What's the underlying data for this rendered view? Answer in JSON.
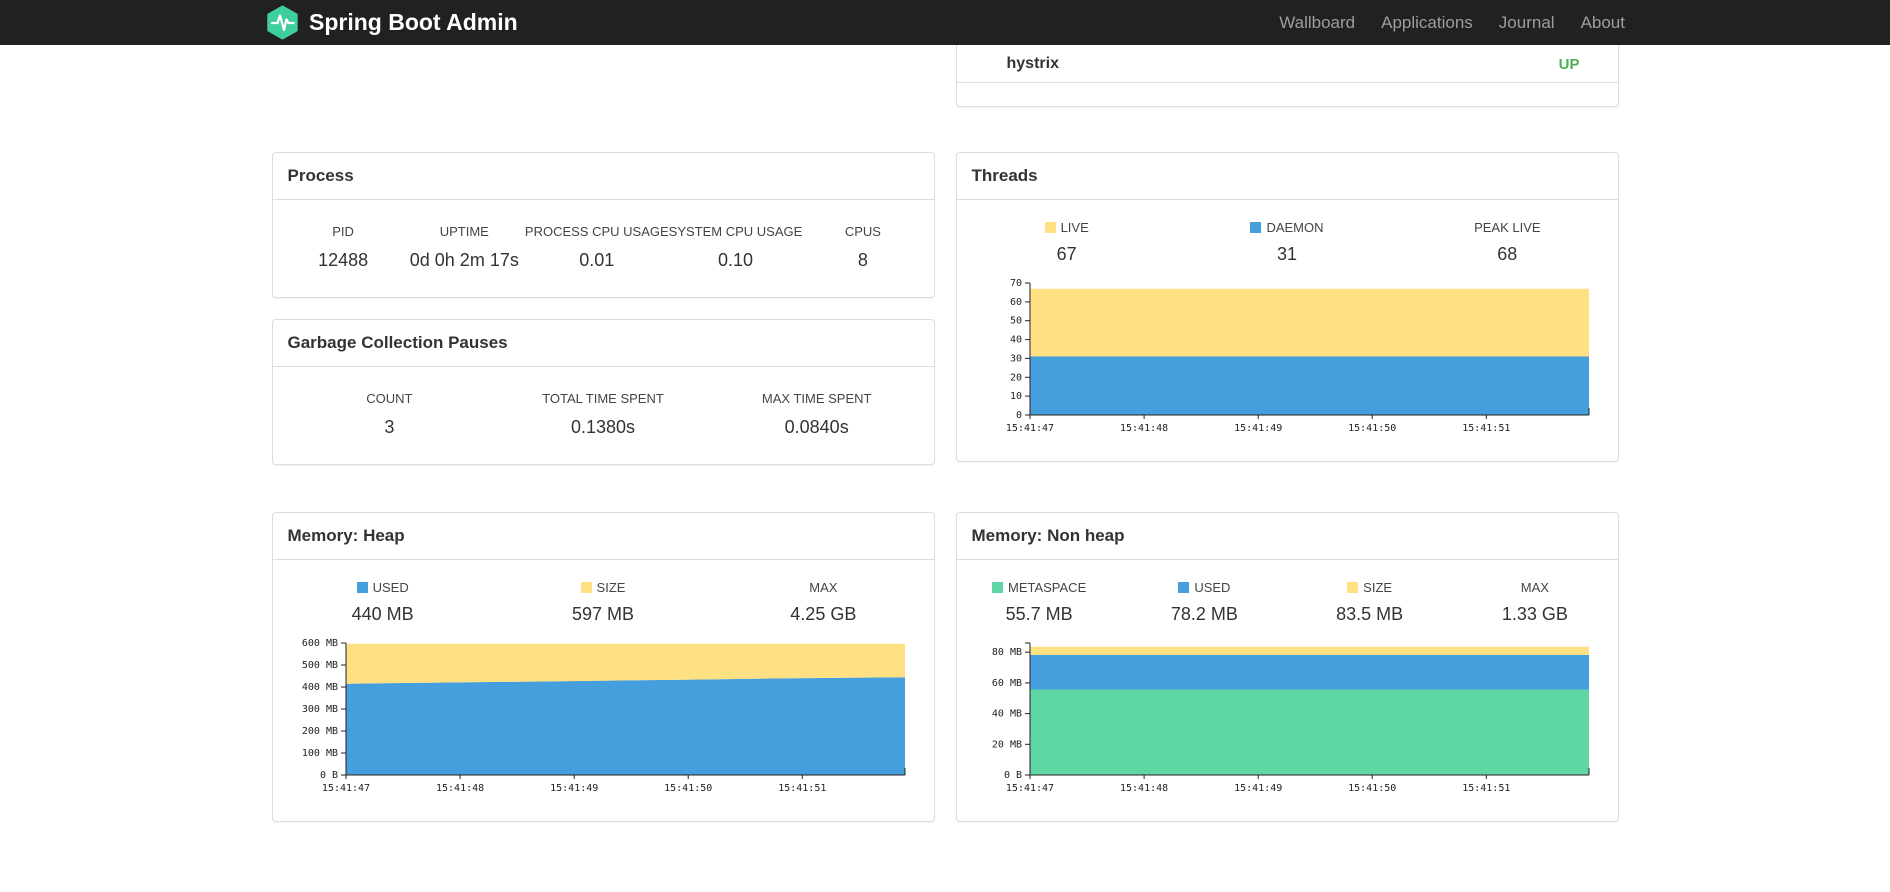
{
  "navbar": {
    "brand": "Spring Boot Admin",
    "links": [
      {
        "label": "Wallboard"
      },
      {
        "label": "Applications"
      },
      {
        "label": "Journal"
      },
      {
        "label": "About"
      }
    ]
  },
  "health_panel": {
    "service": "hystrix",
    "status": "UP",
    "status_color": "#4caf50"
  },
  "process_panel": {
    "title": "Process",
    "stats": [
      {
        "label": "PID",
        "value": "12488"
      },
      {
        "label": "UPTIME",
        "value": "0d 0h 2m 17s"
      },
      {
        "label": "PROCESS CPU USAGE",
        "value": "0.01"
      },
      {
        "label": "SYSTEM CPU USAGE",
        "value": "0.10"
      },
      {
        "label": "CPUS",
        "value": "8"
      }
    ]
  },
  "gc_panel": {
    "title": "Garbage Collection Pauses",
    "stats": [
      {
        "label": "COUNT",
        "value": "3"
      },
      {
        "label": "TOTAL TIME SPENT",
        "value": "0.1380s"
      },
      {
        "label": "MAX TIME SPENT",
        "value": "0.0840s"
      }
    ]
  },
  "threads_panel": {
    "title": "Threads",
    "legend": [
      {
        "label": "LIVE",
        "value": "67",
        "swatch": "#ffe082"
      },
      {
        "label": "DAEMON",
        "value": "31",
        "swatch": "#459fdc"
      },
      {
        "label": "PEAK LIVE",
        "value": "68",
        "swatch": null
      }
    ]
  },
  "heap_panel": {
    "title": "Memory: Heap",
    "legend": [
      {
        "label": "USED",
        "value": "440 MB",
        "swatch": "#459fdc"
      },
      {
        "label": "SIZE",
        "value": "597 MB",
        "swatch": "#ffe082"
      },
      {
        "label": "MAX",
        "value": "4.25 GB",
        "swatch": null
      }
    ]
  },
  "nonheap_panel": {
    "title": "Memory: Non heap",
    "legend": [
      {
        "label": "METASPACE",
        "value": "55.7 MB",
        "swatch": "#5fd7a4"
      },
      {
        "label": "USED",
        "value": "78.2 MB",
        "swatch": "#459fdc"
      },
      {
        "label": "SIZE",
        "value": "83.5 MB",
        "swatch": "#ffe082"
      },
      {
        "label": "MAX",
        "value": "1.33 GB",
        "swatch": null
      }
    ]
  },
  "chart_data": [
    {
      "name": "threads",
      "type": "area",
      "title": "Threads",
      "x_labels": [
        "15:41:47",
        "15:41:48",
        "15:41:49",
        "15:41:50",
        "15:41:51"
      ],
      "y_max": 70,
      "y_ticks": [
        {
          "label": "0",
          "value": 0
        },
        {
          "label": "10",
          "value": 10
        },
        {
          "label": "20",
          "value": 20
        },
        {
          "label": "30",
          "value": 30
        },
        {
          "label": "40",
          "value": 40
        },
        {
          "label": "50",
          "value": 50
        },
        {
          "label": "60",
          "value": 60
        },
        {
          "label": "70",
          "value": 70
        }
      ],
      "bands": [
        {
          "name": "daemon",
          "color": "#459fdc",
          "lower": [
            0
          ],
          "upper": [
            31
          ]
        },
        {
          "name": "live",
          "color": "#ffe082",
          "lower": [
            31
          ],
          "upper": [
            67
          ]
        }
      ],
      "legend_position": "top",
      "grid": false
    },
    {
      "name": "memory-heap",
      "type": "area",
      "title": "Memory: Heap",
      "x_labels": [
        "15:41:47",
        "15:41:48",
        "15:41:49",
        "15:41:50",
        "15:41:51"
      ],
      "y_max": 600,
      "y_ticks": [
        {
          "label": "0 B",
          "value": 0
        },
        {
          "label": "100 MB",
          "value": 100
        },
        {
          "label": "200 MB",
          "value": 200
        },
        {
          "label": "300 MB",
          "value": 300
        },
        {
          "label": "400 MB",
          "value": 400
        },
        {
          "label": "500 MB",
          "value": 500
        },
        {
          "label": "600 MB",
          "value": 600
        }
      ],
      "bands": [
        {
          "name": "used",
          "color": "#459fdc",
          "lower": [
            0
          ],
          "upper": [
            415,
            421,
            427,
            433,
            440,
            444
          ]
        },
        {
          "name": "size",
          "color": "#ffe082",
          "lower": [
            415,
            421,
            427,
            433,
            440,
            444
          ],
          "upper": [
            597
          ]
        }
      ],
      "legend_position": "top",
      "grid": false
    },
    {
      "name": "memory-nonheap",
      "type": "area",
      "title": "Memory: Non heap",
      "x_labels": [
        "15:41:47",
        "15:41:48",
        "15:41:49",
        "15:41:50",
        "15:41:51"
      ],
      "y_max": 86,
      "y_ticks": [
        {
          "label": "0 B",
          "value": 0
        },
        {
          "label": "20 MB",
          "value": 20
        },
        {
          "label": "40 MB",
          "value": 40
        },
        {
          "label": "60 MB",
          "value": 60
        },
        {
          "label": "80 MB",
          "value": 80
        }
      ],
      "bands": [
        {
          "name": "metaspace",
          "color": "#5fd7a4",
          "lower": [
            0
          ],
          "upper": [
            55.7
          ]
        },
        {
          "name": "used",
          "color": "#459fdc",
          "lower": [
            55.7
          ],
          "upper": [
            78.2
          ]
        },
        {
          "name": "size",
          "color": "#ffe082",
          "lower": [
            78.2
          ],
          "upper": [
            83.5
          ]
        }
      ],
      "legend_position": "top",
      "grid": false
    }
  ]
}
